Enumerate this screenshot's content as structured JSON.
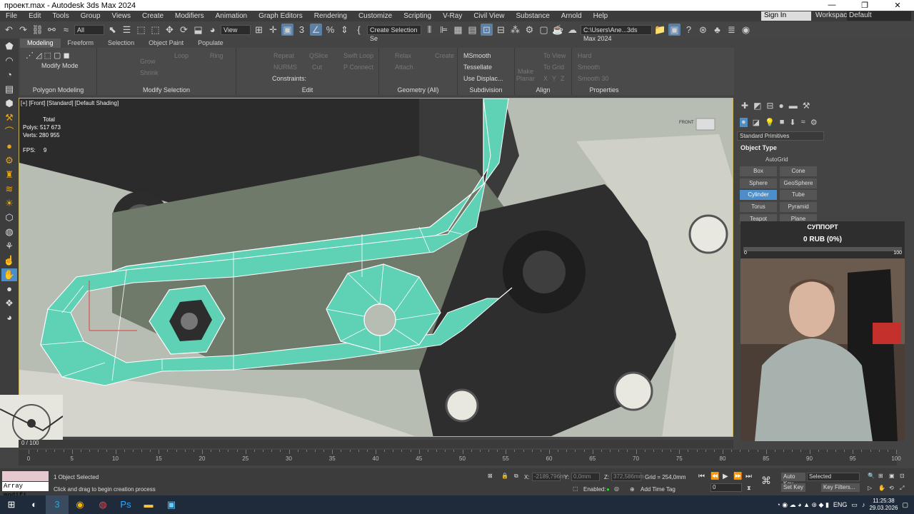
{
  "window": {
    "title": "проект.max - Autodesk 3ds Max 2024",
    "controls": [
      "—",
      "❐",
      "✕"
    ]
  },
  "menu": {
    "items": [
      "File",
      "Edit",
      "Tools",
      "Group",
      "Views",
      "Create",
      "Modifiers",
      "Animation",
      "Graph Editors",
      "Rendering",
      "Customize",
      "Scripting",
      "V-Ray",
      "Civil View",
      "Substance",
      "Arnold",
      "Help"
    ],
    "sign_in": "Sign In",
    "workspaces_label": "Workspaces:",
    "workspace_value": "Default"
  },
  "toolbar": {
    "selection_filter": "All",
    "ref_coord": "View",
    "named_selection": "Create Selection Se",
    "project_path": "C:\\Users\\Ane...3ds Max 2024"
  },
  "ribbon": {
    "tabs": [
      "Modeling",
      "Freeform",
      "Selection",
      "Object Paint",
      "Populate"
    ],
    "active_tab": "Modeling",
    "groups": {
      "polygon_modeling": "Polygon Modeling",
      "modify_selection": "Modify Selection",
      "edit": "Edit",
      "geometry": "Geometry (All)",
      "subdivision": "Subdivision",
      "align": "Align",
      "properties": "Properties"
    },
    "modify_mode": "Modify Mode",
    "buttons": {
      "grow": "Grow",
      "shrink": "Shrink",
      "loop": "Loop",
      "ring": "Ring",
      "repeat": "Repeat",
      "qslice": "QSlice",
      "swift_loop": "Swift Loop",
      "nurms": "NURMS",
      "cut": "Cut",
      "p_connect": "P Connect",
      "constraints": "Constraints:",
      "relax": "Relax",
      "create": "Create",
      "attach": "Attach",
      "msmooth": "MSmooth",
      "tessellate": "Tessellate",
      "use_displac": "Use Displac...",
      "make_planar": "Make Planar",
      "to_view": "To View",
      "to_grid": "To Grid",
      "x": "X",
      "y": "Y",
      "z": "Z",
      "hard": "Hard",
      "smooth": "Smooth",
      "smooth30": "Smooth 30"
    }
  },
  "viewport": {
    "label": "[+] [Front] [Standard] [Default Shading]",
    "stats_total": "Total",
    "polys_label": "Polys:",
    "polys_value": "517 673",
    "verts_label": "Verts:",
    "verts_value": "280 955",
    "fps_label": "FPS:",
    "fps_value": "9",
    "viewcube": "FRONT"
  },
  "command_panel": {
    "category": "Standard Primitives",
    "rollout": "Object Type",
    "autogrid": "AutoGrid",
    "primitives": [
      "Box",
      "Cone",
      "Sphere",
      "GeoSphere",
      "Cylinder",
      "Tube",
      "Torus",
      "Pyramid",
      "Teapot",
      "Plane"
    ],
    "active_primitive": "Cylinder"
  },
  "donation": {
    "title": "СУППОРТ",
    "amount": "0 RUB (0%)",
    "min": "0",
    "max": "100",
    "progress": 0
  },
  "timeline": {
    "position": "0 / 100",
    "ticks": [
      "0",
      "5",
      "10",
      "15",
      "20",
      "25",
      "30",
      "35",
      "40",
      "45",
      "50",
      "55",
      "60",
      "65",
      "70",
      "75",
      "80",
      "85",
      "90",
      "95",
      "100"
    ]
  },
  "status": {
    "selected": "1 Object Selected",
    "prompt": "Click and drag to begin creation process",
    "maxscript_value": "Array modifi",
    "x_label": "X:",
    "x_value": "-2189,796m",
    "y_label": "Y:",
    "y_value": "0,0mm",
    "z_label": "Z:",
    "z_value": "372,586mm",
    "grid": "Grid = 254,0mm",
    "enabled": "Enabled:",
    "add_time_tag": "Add Time Tag",
    "auto_key": "Auto Key",
    "key_mode": "Selected",
    "set_key": "Set Key",
    "key_filters": "Key Filters...",
    "frame": "0"
  },
  "taskbar": {
    "lang": "ENG",
    "time": "11:25:38",
    "date": "29.03.2026"
  },
  "colors": {
    "accent": "#4c8ec9",
    "mesh": "#5fd1b5",
    "selection_border": "#c8b45a"
  }
}
